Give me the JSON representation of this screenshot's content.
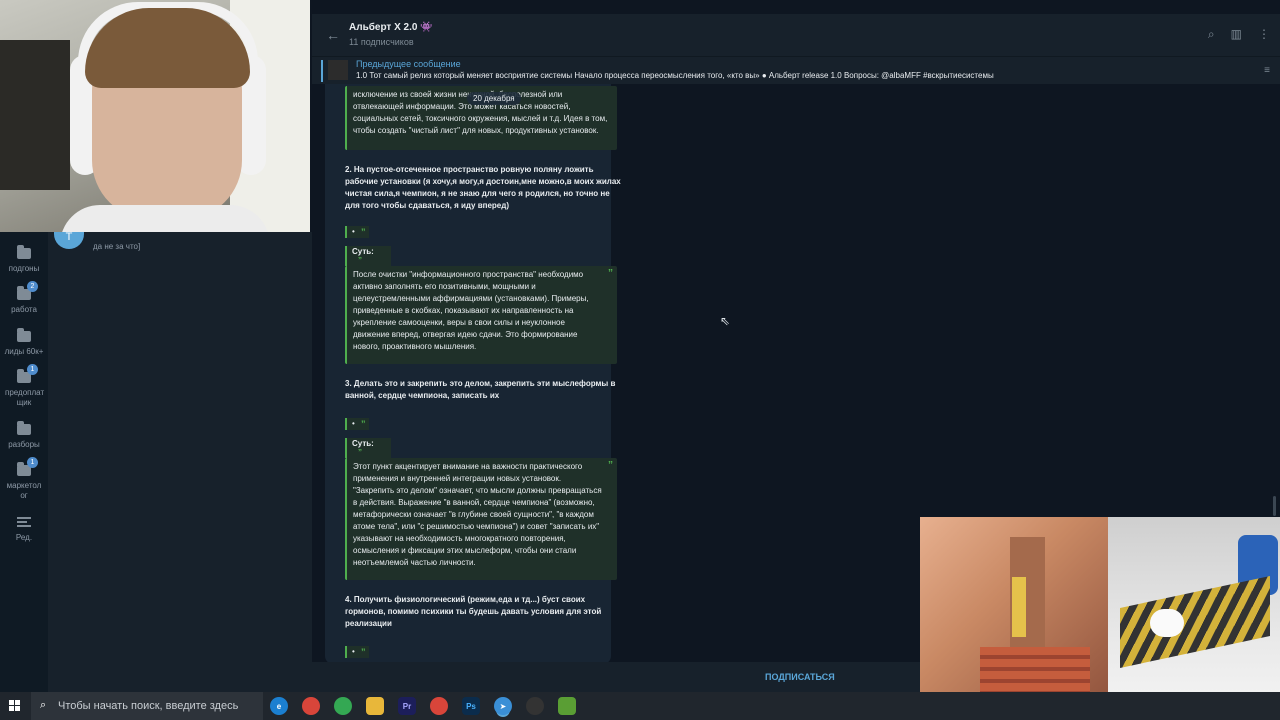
{
  "header": {
    "title": "Альберт Х 2.0 👾",
    "subscribers": "11 подписчиков"
  },
  "pinned": {
    "title": "Предыдущее сообщение",
    "text": "1.0  Тот самый релиз который меняет восприятие системы  Начало процесса переосмысления того, «кто вы» ● Альберт release 1.0  Вопросы: @albaMFF #вскрытиесистемы"
  },
  "folders": [
    {
      "label": "подгоны",
      "badge": ""
    },
    {
      "label": "работа",
      "badge": "2"
    },
    {
      "label": "лиды 60к+",
      "badge": ""
    },
    {
      "label": "предоплат щик",
      "badge": "1"
    },
    {
      "label": "разборы",
      "badge": ""
    },
    {
      "label": "маркетол ог",
      "badge": "1"
    },
    {
      "label": "Ред.",
      "badge": ""
    }
  ],
  "chat": {
    "avatar_letter": "Т",
    "preview": "да не за что]"
  },
  "message": {
    "date_pill": "20 декабря",
    "quote_top": "исключение из своей жизни ненужной, бесполезной или отвлекающей информации. Это может касаться новостей, социальных сетей, токсичного окружения, мыслей и т.д. Идея в том, чтобы создать \"чистый лист\" для новых, продуктивных установок.",
    "point2": "2. На пустое-отсеченное пространство ровную поляну ложить рабочие установки (я хочу,я могу,я достоин,мне можно,в моих жилах чистая сила,я чемпион, я не знаю для чего я родился, но точно не для того чтобы сдаваться, я иду вперед)",
    "small_quote": "•",
    "sut_label": "Суть:",
    "quote2": "После очистки \"информационного пространства\" необходимо активно заполнять его позитивными, мощными и целеустремленными аффирмациями (установками). Примеры, приведенные в скобках, показывают их направленность на укрепление самооценки, веры в свои силы и неуклонное движение вперед, отвергая идею сдачи. Это формирование нового, проактивного мышления.",
    "point3": "3. Делать это и закрепить это делом, закрепить эти мыслеформы в ванной, сердце чемпиона, записать их",
    "quote3": "Этот пункт акцентирует внимание на важности практического применения и внутренней интеграции новых установок. \"Закрепить это делом\" означает, что мысли должны превращаться в действия. Выражение \"в ванной, сердце чемпиона\" (возможно, метафорически означает \"в глубине своей сущности\", \"в каждом атоме тела\", или \"с решимостью чемпиона\") и совет \"записать их\" указывают на необходимость многократного повторения, осмысления и фиксации этих мыслеформ, чтобы они стали неотъемлемой частью личности.",
    "point4": "4. Получить физиологический (режим,еда и тд...) буст своих гормонов, помимо психики ты будешь давать условия для этой реализации",
    "quote_mark": "”"
  },
  "subscribe_label": "ПОДПИСАТЬСЯ",
  "taskbar": {
    "search_placeholder": "Чтобы начать поиск, введите здесь",
    "apps": [
      "edge-icon",
      "chrome-icon",
      "chrome-icon",
      "explorer-icon",
      "premiere-icon",
      "chrome-icon",
      "photoshop-icon",
      "telegram-icon",
      "obs-icon",
      "minecraft-icon"
    ]
  },
  "colors": {
    "accent": "#5aa6d8",
    "quote_green": "#4fae4e",
    "bg": "#0e1621",
    "panel": "#17212b"
  }
}
